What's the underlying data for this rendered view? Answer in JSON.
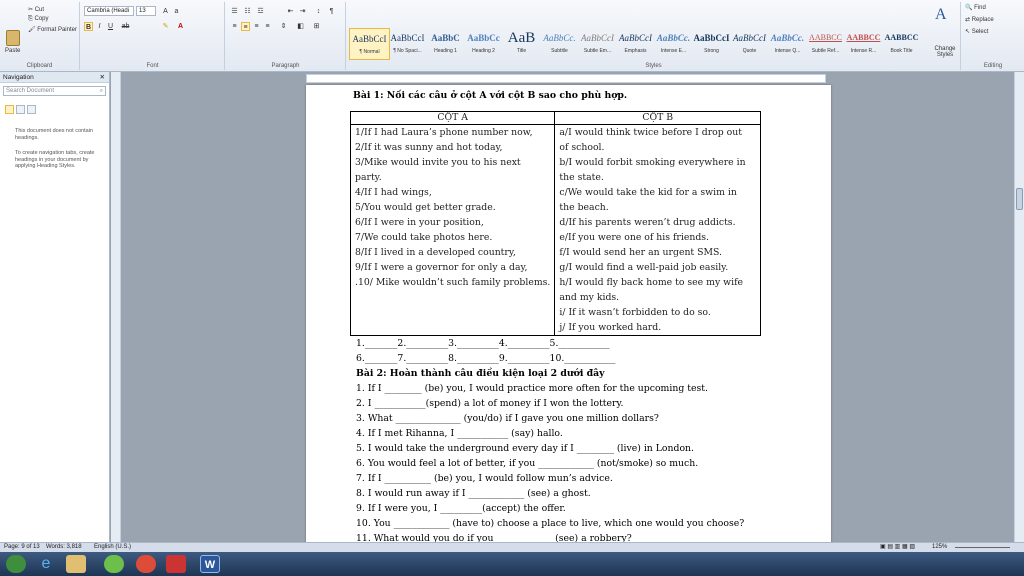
{
  "ribbon": {
    "clipboard": {
      "cut": "Cut",
      "copy": "Copy",
      "paste": "Paste",
      "format_painter": "Format Painter",
      "label": "Clipboard"
    },
    "font": {
      "name": "Cambria (Headi",
      "size": "13",
      "label": "Font"
    },
    "paragraph": {
      "label": "Paragraph"
    },
    "styles": {
      "label": "Styles",
      "items": [
        {
          "preview": "AaBbCcI",
          "name": "¶ Normal"
        },
        {
          "preview": "AaBbCcI",
          "name": "¶ No Spaci..."
        },
        {
          "preview": "AaBbC",
          "name": "Heading 1"
        },
        {
          "preview": "AaBbCc",
          "name": "Heading 2"
        },
        {
          "preview": "AaB",
          "name": "Title"
        },
        {
          "preview": "AaBbCc.",
          "name": "Subtitle"
        },
        {
          "preview": "AaBbCcI",
          "name": "Subtle Em..."
        },
        {
          "preview": "AaBbCcI",
          "name": "Emphasis"
        },
        {
          "preview": "AaBbCc.",
          "name": "Intense E..."
        },
        {
          "preview": "AaBbCcI",
          "name": "Strong"
        },
        {
          "preview": "AaBbCcI",
          "name": "Quote"
        },
        {
          "preview": "AaBbCc.",
          "name": "Intense Q..."
        },
        {
          "preview": "AABBCC",
          "name": "Subtle Ref..."
        },
        {
          "preview": "AABBCC",
          "name": "Intense R..."
        },
        {
          "preview": "AABBCC",
          "name": "Book Title"
        }
      ],
      "change_styles": "Change Styles"
    },
    "editing": {
      "find": "Find",
      "replace": "Replace",
      "select": "Select",
      "label": "Editing"
    }
  },
  "navigation": {
    "title": "Navigation",
    "search_placeholder": "Search Document",
    "msg1": "This document does not contain headings.",
    "msg2": "To create navigation tabs, create headings in your document by applying Heading Styles."
  },
  "document": {
    "ex1_title": "Bài 1: Nối các câu ở cột A với cột B sao cho phù hợp.",
    "col_a": "CỘT A",
    "col_b": "CỘT B",
    "a_items": [
      "1/If I had Laura’s phone number now,",
      "2/If it was sunny and hot today,",
      "3/Mike would invite you to his next",
      "party.",
      "4/If I had wings,",
      "5/You would get better grade.",
      "6/If I were in your position,",
      "7/We could take photos here.",
      "8/If I lived in a developed country,",
      "9/If I were a governor for only a day,",
      ".10/ Mike wouldn’t such family problems."
    ],
    "b_items": [
      "a/I would think twice before I drop out",
      "of school.",
      "b/I would forbit smoking everywhere in",
      "the state.",
      "c/We would take the kid for a swim in",
      "the beach.",
      "d/If his parents weren’t drug addicts.",
      "e/If you were one of his friends.",
      "f/I would send her an urgent SMS.",
      "g/I would find a well-paid job easily.",
      "h/I would fly back home to see my wife",
      "and my kids.",
      "i/ If it wasn’t forbidden to do so.",
      "j/ If you worked hard."
    ],
    "answers1": "1._______2._________3._________4._________5.___________",
    "answers2": "6._______7._________8._________9._________10.___________",
    "ex2_title": "Bài 2: Hoàn thành câu điều kiện loại 2 dưới đây",
    "ex2_items": [
      "1. If I ________ (be) you, I would practice more often for the upcoming test.",
      "2. I ___________(spend) a lot of money if I won the lottery.",
      "3. What ______________ (you/do) if I gave you one million dollars?",
      "4. If I met Rihanna, I ___________ (say) hallo.",
      "5. I would take the underground every day if I ________ (live) in London.",
      "6. You would feel a lot of better, if you ____________ (not/smoke) so much.",
      "7. If I __________ (be) you, I would follow mun’s advice.",
      "8. I would run away if I ____________ (see) a ghost.",
      "9. If I were you, I _________(accept) the offer.",
      "10. You ____________ (have to) choose a place to live, which one would you choose?",
      "11. What would you do if you ____________ (see) a robbery?"
    ]
  },
  "status": {
    "page": "Page: 9 of 13",
    "words": "Words: 3,818",
    "language": "English (U.S.)",
    "zoom": "125%"
  },
  "colors": {
    "accent": "#2b579a",
    "taskbar": "#1e3554"
  }
}
